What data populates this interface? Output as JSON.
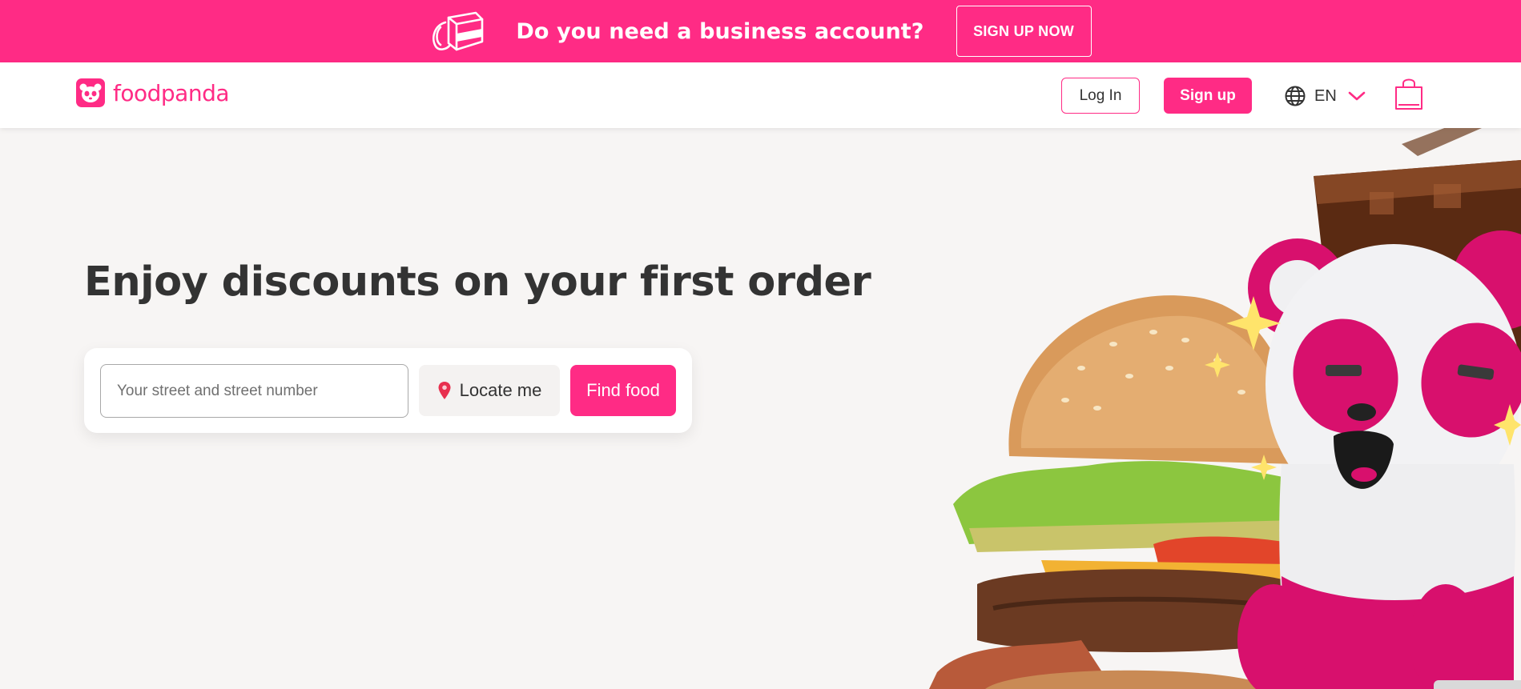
{
  "promo": {
    "icon": "delivery-bag-icon",
    "text": "Do you need a business account?",
    "button_label": "SIGN UP NOW"
  },
  "header": {
    "logo_icon": "panda-logo-icon",
    "logo_text": "foodpanda",
    "login_label": "Log In",
    "signup_label": "Sign up",
    "language": {
      "icon": "globe-icon",
      "code": "EN",
      "chevron": "chevron-down-icon"
    },
    "cart_icon": "shopping-bag-icon"
  },
  "hero": {
    "title": "Enjoy discounts on your first order",
    "search": {
      "placeholder": "Your street and street number",
      "value": "",
      "locate_label": "Locate me",
      "locate_icon": "location-pin-icon",
      "find_label": "Find food"
    },
    "illustration": "panda-mascot-with-burger-and-drink"
  },
  "colors": {
    "brand": "#ff2b85",
    "background": "#f7f5f4",
    "text": "#333333"
  }
}
